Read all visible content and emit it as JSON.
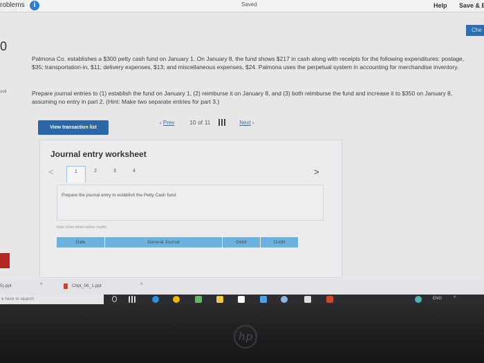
{
  "topbar": {
    "problems_label": "roblems",
    "info_icon": "i",
    "saved": "Saved",
    "help": "Help",
    "save_exit": "Save & E"
  },
  "check_button": "Che",
  "question_number": "0",
  "book_label": "ook",
  "problem": {
    "text": "Palmona Co. establishes a $300 petty cash fund on January 1. On January 8, the fund shows $217 in cash along with receipts for the following expenditures: postage, $35; transportation-in, $11; delivery expenses, $13; and miscellaneous expenses, $24. Palmona uses the perpetual system in accounting for merchandise inventory.",
    "instruction": "Prepare journal entries to (1) establish the fund on January 1, (2) reimburse it on January 8, and (3) both reimburse the fund and increase it to $350 on January 8, assuming no entry in part 2. (Hint: Make two separate entries for part 3.)"
  },
  "view_transaction_button": "View transaction list",
  "worksheet": {
    "title": "Journal entry worksheet",
    "prev_arrow": "<",
    "next_arrow": ">",
    "steps": [
      "1",
      "2",
      "3",
      "4"
    ],
    "task": "Prepare the journal entry to establish the Petty Cash fund.",
    "note": "Note: Enter debits before credits.",
    "columns": [
      "Date",
      "General Journal",
      "Debit",
      "Credit"
    ]
  },
  "pager": {
    "prev": "Prev",
    "current": "10",
    "of": "of",
    "total": "11",
    "next": "Next"
  },
  "downloads": {
    "file1": "5).ppt",
    "file2": "Chpt_06_1.ppt"
  },
  "taskbar": {
    "search_placeholder": "e here to search",
    "tray_text": "ENG"
  },
  "colors": {
    "primary_blue": "#2b66a6",
    "table_header": "#6db2dc",
    "info_blue": "#2d7fcf"
  }
}
